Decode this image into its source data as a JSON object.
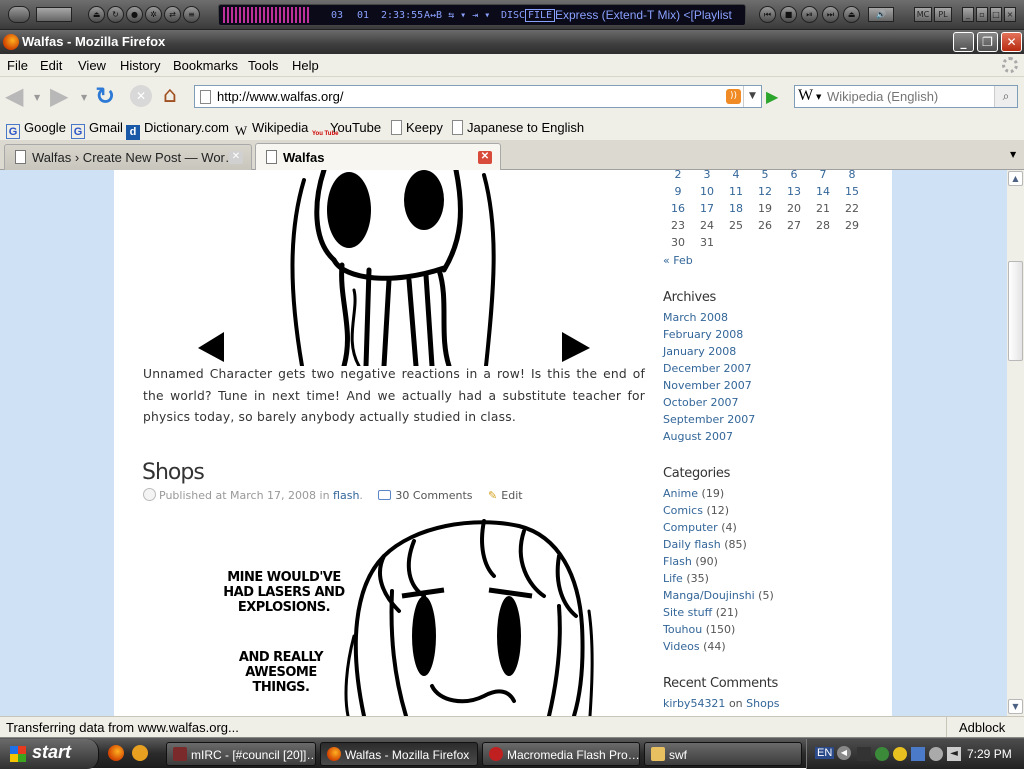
{
  "winamp": {
    "lcd_track": "03",
    "lcd_album": "01",
    "lcd_time": "2:33:55",
    "lcd_flags": "A↔B  ⇆ ▾  ⇥ ▾",
    "lcd_disc": "DISC",
    "lcd_file": "FILE",
    "lcd_title": "Express (Extend-T Mix)   <[Playlist",
    "mini_btns": [
      "MC",
      "PL"
    ]
  },
  "window": {
    "title": "Walfas - Mozilla Firefox"
  },
  "menu": [
    "File",
    "Edit",
    "View",
    "History",
    "Bookmarks",
    "Tools",
    "Help"
  ],
  "nav": {
    "url": "http://www.walfas.org/",
    "search_placeholder": "Wikipedia (English)",
    "search_engine": "W"
  },
  "bookmarks": [
    {
      "label": "Google",
      "icon": "G"
    },
    {
      "label": "Gmail",
      "icon": "G"
    },
    {
      "label": "Dictionary.com",
      "icon": "dictionary-icon"
    },
    {
      "label": "Wikipedia",
      "icon": "W"
    },
    {
      "label": "YouTube",
      "icon": "You Tube"
    },
    {
      "label": "Keepy",
      "icon": "page-icon"
    },
    {
      "label": "Japanese to English",
      "icon": "page-icon"
    }
  ],
  "tabs": [
    {
      "label": "Walfas › Create New Post — Wor…",
      "active": false
    },
    {
      "label": "Walfas",
      "active": true
    }
  ],
  "post1": {
    "body": "Unnamed Character gets two negative reactions in a row! Is this the end of the world? Tune in next time! And we actually had a substitute teacher for physics today, so barely anybody actually studied in class."
  },
  "post2": {
    "title": "Shops",
    "meta_prefix": "Published at March 17, 2008 in",
    "category": "flash",
    "comments": "30 Comments",
    "edit": "Edit",
    "comic_text_1": "MINE WOULD'VE HAD LASERS AND EXPLOSIONS.",
    "comic_text_2": "AND REALLY AWESOME THINGS."
  },
  "calendar": {
    "rows": [
      [
        "2",
        "3",
        "4",
        "5",
        "6",
        "7",
        "8"
      ],
      [
        "9",
        "10",
        "11",
        "12",
        "13",
        "14",
        "15"
      ],
      [
        "16",
        "17",
        "18",
        "19",
        "20",
        "21",
        "22"
      ],
      [
        "23",
        "24",
        "25",
        "26",
        "27",
        "28",
        "29"
      ],
      [
        "30",
        "31"
      ]
    ],
    "linked": [
      "2",
      "3",
      "4",
      "5",
      "6",
      "7",
      "8",
      "9",
      "10",
      "11",
      "12",
      "13",
      "14",
      "15",
      "16",
      "17",
      "18"
    ],
    "prev": "« Feb"
  },
  "archives": {
    "heading": "Archives",
    "items": [
      "March 2008",
      "February 2008",
      "January 2008",
      "December 2007",
      "November 2007",
      "October 2007",
      "September 2007",
      "August 2007"
    ]
  },
  "categories": {
    "heading": "Categories",
    "items": [
      {
        "name": "Anime",
        "count": "(19)"
      },
      {
        "name": "Comics",
        "count": "(12)"
      },
      {
        "name": "Computer",
        "count": "(4)"
      },
      {
        "name": "Daily flash",
        "count": "(85)"
      },
      {
        "name": "Flash",
        "count": "(90)"
      },
      {
        "name": "Life",
        "count": "(35)"
      },
      {
        "name": "Manga/Doujinshi",
        "count": "(5)"
      },
      {
        "name": "Site stuff",
        "count": "(21)"
      },
      {
        "name": "Touhou",
        "count": "(150)"
      },
      {
        "name": "Videos",
        "count": "(44)"
      }
    ]
  },
  "recent_comments": {
    "heading": "Recent Comments",
    "author": "kirby54321",
    "on": "on",
    "post": "Shops"
  },
  "status": {
    "text": "Transferring data from www.walfas.org...",
    "addon": "Adblock"
  },
  "taskbar": {
    "start": "start",
    "items": [
      {
        "label": "mIRC - [#council [20]]…",
        "active": false
      },
      {
        "label": "Walfas - Mozilla Firefox",
        "active": true
      },
      {
        "label": "Macromedia Flash Pro…",
        "active": false
      },
      {
        "label": "swf",
        "active": false
      }
    ],
    "lang": "EN",
    "clock": "7:29 PM"
  },
  "colors": {
    "link": "#336699",
    "page_bg": "#cfe2f5",
    "text": "#333333"
  }
}
